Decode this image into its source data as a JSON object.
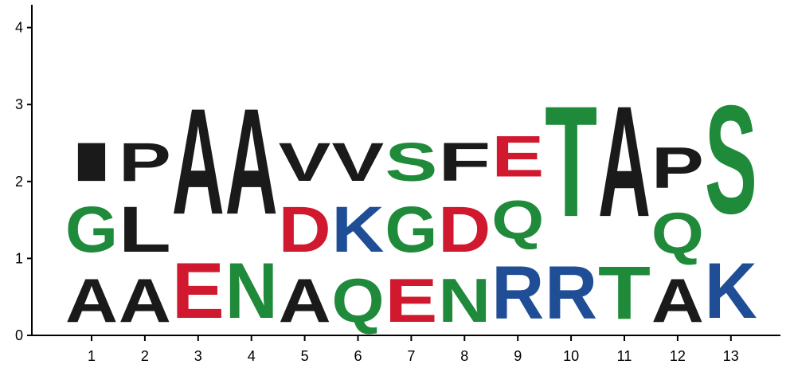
{
  "chart_data": {
    "type": "sequence-logo",
    "title": "",
    "xlabel": "",
    "ylabel": "",
    "ylim": [
      0,
      4.2
    ],
    "y_ticks": [
      "0",
      "1",
      "2",
      "3",
      "4"
    ],
    "positions": [
      "1",
      "2",
      "3",
      "4",
      "5",
      "6",
      "7",
      "8",
      "9",
      "10",
      "11",
      "12",
      "13"
    ],
    "grid": false,
    "legend": "none",
    "colors": {
      "hydrophobic": "#1a1a1a",
      "polar": "#1e8a3a",
      "acidic": "#d0182e",
      "basic": "#1f4e96"
    },
    "stacks": [
      [
        {
          "letter": "A",
          "height": 0.9,
          "color": "#1a1a1a"
        },
        {
          "letter": "G",
          "height": 0.95,
          "color": "#1e8a3a"
        },
        {
          "letter": "I",
          "height": 0.8,
          "color": "#1a1a1a"
        }
      ],
      [
        {
          "letter": "A",
          "height": 0.9,
          "color": "#1a1a1a"
        },
        {
          "letter": "L",
          "height": 0.95,
          "color": "#1a1a1a"
        },
        {
          "letter": "P",
          "height": 0.8,
          "color": "#1a1a1a"
        }
      ],
      [
        {
          "letter": "E",
          "height": 1.15,
          "color": "#d0182e"
        },
        {
          "letter": "A",
          "height": 2.2,
          "color": "#1a1a1a"
        }
      ],
      [
        {
          "letter": "N",
          "height": 1.15,
          "color": "#1e8a3a"
        },
        {
          "letter": "A",
          "height": 2.2,
          "color": "#1a1a1a"
        }
      ],
      [
        {
          "letter": "A",
          "height": 0.9,
          "color": "#1a1a1a"
        },
        {
          "letter": "D",
          "height": 0.95,
          "color": "#d0182e"
        },
        {
          "letter": "V",
          "height": 0.8,
          "color": "#1a1a1a"
        }
      ],
      [
        {
          "letter": "Q",
          "height": 0.9,
          "color": "#1e8a3a"
        },
        {
          "letter": "K",
          "height": 0.95,
          "color": "#1f4e96"
        },
        {
          "letter": "V",
          "height": 0.8,
          "color": "#1a1a1a"
        }
      ],
      [
        {
          "letter": "E",
          "height": 0.9,
          "color": "#d0182e"
        },
        {
          "letter": "G",
          "height": 0.95,
          "color": "#1e8a3a"
        },
        {
          "letter": "S",
          "height": 0.8,
          "color": "#1e8a3a"
        }
      ],
      [
        {
          "letter": "N",
          "height": 0.9,
          "color": "#1e8a3a"
        },
        {
          "letter": "D",
          "height": 0.95,
          "color": "#d0182e"
        },
        {
          "letter": "F",
          "height": 0.8,
          "color": "#1a1a1a"
        }
      ],
      [
        {
          "letter": "R",
          "height": 1.1,
          "color": "#1f4e96"
        },
        {
          "letter": "Q",
          "height": 0.8,
          "color": "#1e8a3a"
        },
        {
          "letter": "E",
          "height": 0.85,
          "color": "#d0182e"
        }
      ],
      [
        {
          "letter": "R",
          "height": 1.1,
          "color": "#1f4e96"
        },
        {
          "letter": "T",
          "height": 2.3,
          "color": "#1e8a3a"
        }
      ],
      [
        {
          "letter": "T",
          "height": 1.1,
          "color": "#1e8a3a"
        },
        {
          "letter": "A",
          "height": 2.3,
          "color": "#1a1a1a"
        }
      ],
      [
        {
          "letter": "A",
          "height": 0.9,
          "color": "#1a1a1a"
        },
        {
          "letter": "Q",
          "height": 0.85,
          "color": "#1e8a3a"
        },
        {
          "letter": "P",
          "height": 0.85,
          "color": "#1a1a1a"
        }
      ],
      [
        {
          "letter": "K",
          "height": 1.15,
          "color": "#1f4e96"
        },
        {
          "letter": "S",
          "height": 2.25,
          "color": "#1e8a3a"
        }
      ]
    ]
  }
}
